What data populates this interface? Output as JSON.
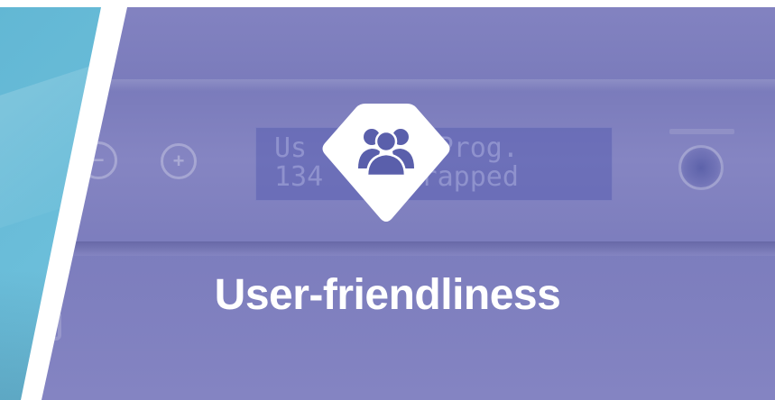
{
  "banner": {
    "title": "User-friendliness",
    "icon": "users-group-icon",
    "colors": {
      "overlay": "#8383c1",
      "left_panel": "#6fbfd9",
      "badge_bg": "#ffffff",
      "badge_icon": "#5a5fab",
      "title_text": "#ffffff"
    }
  },
  "background_device": {
    "display_line_1": "Us        Prog.",
    "display_line_2": "134     Wrapped",
    "buttons": [
      {
        "icon": "minus-icon",
        "glyph": "−"
      },
      {
        "icon": "plus-icon",
        "glyph": "+"
      }
    ]
  }
}
